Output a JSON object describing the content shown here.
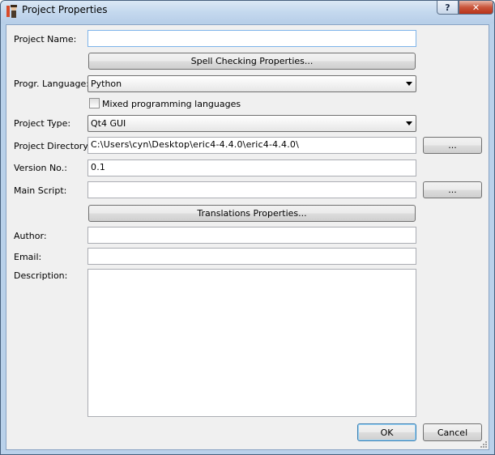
{
  "window": {
    "title": "Project Properties",
    "help_label": "?",
    "close_label": "✕"
  },
  "form": {
    "project_name": {
      "label": "Project Name:",
      "value": ""
    },
    "spell_button": "Spell Checking Properties...",
    "language": {
      "label": "Progr. Language:",
      "value": "Python"
    },
    "mixed": {
      "label": "Mixed programming languages",
      "checked": false
    },
    "project_type": {
      "label": "Project Type:",
      "value": "Qt4 GUI"
    },
    "directory": {
      "label": "Project Directory:",
      "value": "C:\\Users\\cyn\\Desktop\\eric4-4.4.0\\eric4-4.4.0\\",
      "browse": "..."
    },
    "version": {
      "label": "Version No.:",
      "value": "0.1"
    },
    "main_script": {
      "label": "Main Script:",
      "value": "",
      "browse": "..."
    },
    "translations_button": "Translations Properties...",
    "author": {
      "label": "Author:",
      "value": ""
    },
    "email": {
      "label": "Email:",
      "value": ""
    },
    "description": {
      "label": "Description:",
      "value": ""
    }
  },
  "footer": {
    "ok": "OK",
    "cancel": "Cancel"
  }
}
